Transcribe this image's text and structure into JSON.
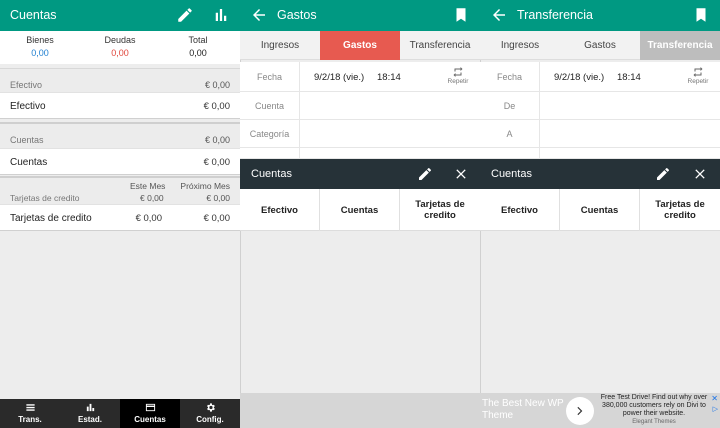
{
  "cuentas": {
    "title": "Cuentas",
    "edit_icon": "pencil-icon",
    "chart_icon": "bar-chart-icon",
    "summary": [
      {
        "label": "Bienes",
        "value": "0,00",
        "color": "#1f7fd0"
      },
      {
        "label": "Deudas",
        "value": "0,00",
        "color": "#e0463c"
      },
      {
        "label": "Total",
        "value": "0,00",
        "color": "#222222"
      }
    ],
    "groups": [
      {
        "header": "Efectivo",
        "header_value": "€ 0,00",
        "row": "Efectivo",
        "row_value": "€ 0,00"
      },
      {
        "header": "Cuentas",
        "header_value": "€ 0,00",
        "row": "Cuentas",
        "row_value": "€ 0,00"
      }
    ],
    "credit": {
      "col1": "Este Mes",
      "col2": "Próximo Mes",
      "header": "Tarjetas de credito",
      "header_v1": "€ 0,00",
      "header_v2": "€ 0,00",
      "row": "Tarjetas de credito",
      "row_v1": "€ 0,00",
      "row_v2": "€ 0,00"
    },
    "nav": [
      {
        "label": "Trans.",
        "icon": "list-icon",
        "active": false
      },
      {
        "label": "Estad.",
        "icon": "bar-chart-icon",
        "active": false
      },
      {
        "label": "Cuentas",
        "icon": "card-icon",
        "active": true
      },
      {
        "label": "Config.",
        "icon": "gear-icon",
        "active": false
      }
    ]
  },
  "gastos": {
    "title": "Gastos",
    "tabs": [
      "Ingresos",
      "Gastos",
      "Transferencia"
    ],
    "fecha_label": "Fecha",
    "date": "9/2/18 (vie.)",
    "time": "18:14",
    "repeat_label": "Repetir",
    "cuenta_label": "Cuenta",
    "categoria_label": "Categoría"
  },
  "transferencia": {
    "title": "Transferencia",
    "tabs": [
      "Ingresos",
      "Gastos",
      "Transferencia"
    ],
    "fecha_label": "Fecha",
    "date": "9/2/18 (vie.)",
    "time": "18:14",
    "repeat_label": "Repetir",
    "de_label": "De",
    "a_label": "A"
  },
  "dialog": {
    "title": "Cuentas",
    "options": [
      "Efectivo",
      "Cuentas",
      "Tarjetas de credito"
    ]
  },
  "ad": {
    "left_text": "The Best New WP Theme",
    "right_text": "Free Test Drive! Find out why over 380,000 customers rely on Divi to power their website.",
    "brand": "Elegant Themes"
  },
  "colors": {
    "appbar": "#009982",
    "active_tab_red": "#e75a50",
    "active_tab_grey": "#bdbdbd",
    "dialog_bar": "#263238"
  }
}
